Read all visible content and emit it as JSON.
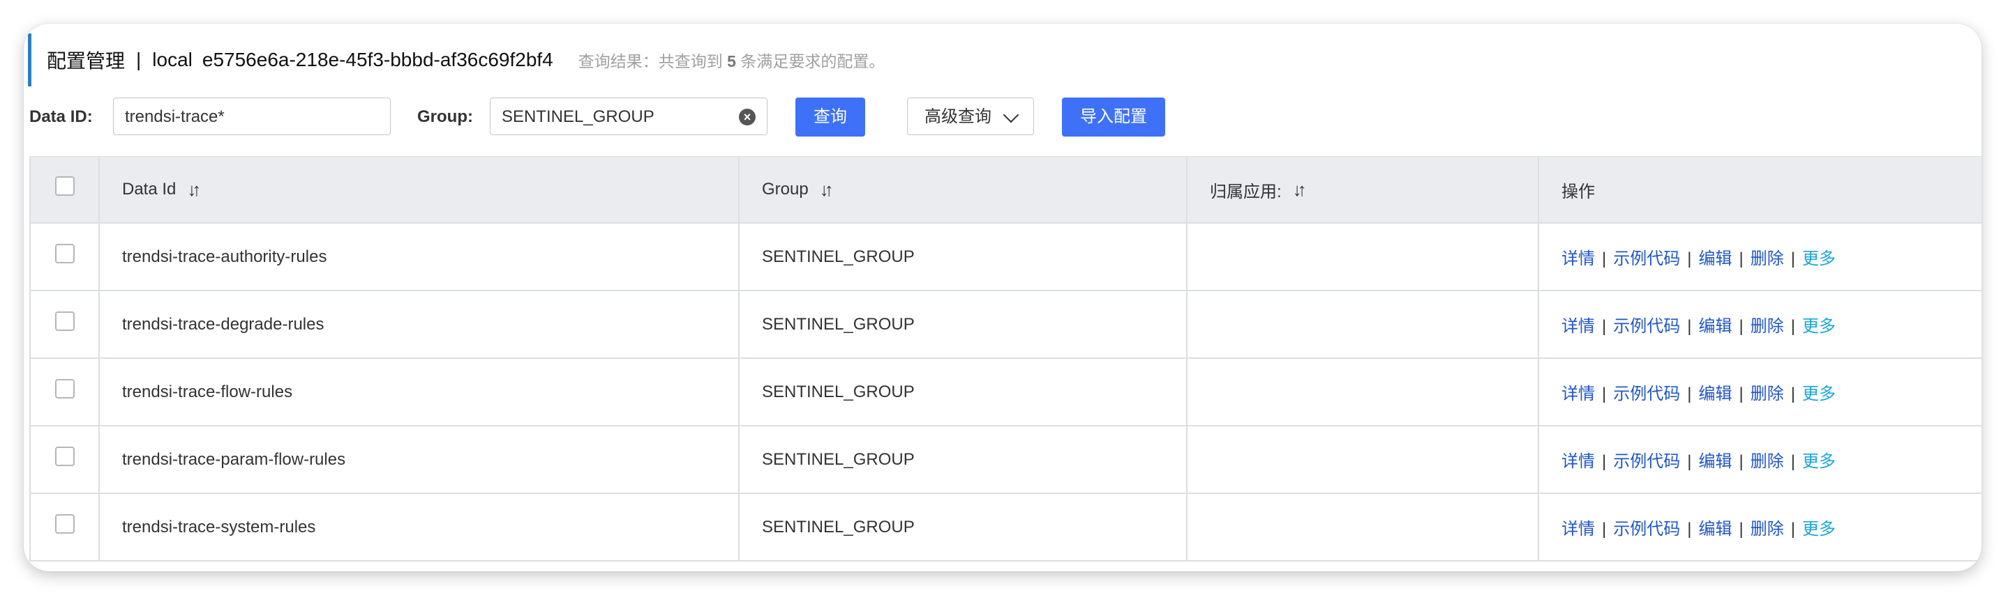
{
  "header": {
    "title": "配置管理",
    "separator": "|",
    "namespace_name": "local",
    "namespace_id": "e5756e6a-218e-45f3-bbbd-af36c69f2bf4",
    "result_prefix": "查询结果：共查询到",
    "result_count": "5",
    "result_suffix": "条满足要求的配置。"
  },
  "search": {
    "data_id_label": "Data ID:",
    "data_id_value": "trendsi-trace*",
    "group_label": "Group:",
    "group_value": "SENTINEL_GROUP",
    "query_button": "查询",
    "advanced_button": "高级查询",
    "import_button": "导入配置"
  },
  "table": {
    "columns": {
      "data_id": "Data Id",
      "group": "Group",
      "app": "归属应用:",
      "actions": "操作"
    },
    "rows": [
      {
        "data_id": "trendsi-trace-authority-rules",
        "group": "SENTINEL_GROUP",
        "app": ""
      },
      {
        "data_id": "trendsi-trace-degrade-rules",
        "group": "SENTINEL_GROUP",
        "app": ""
      },
      {
        "data_id": "trendsi-trace-flow-rules",
        "group": "SENTINEL_GROUP",
        "app": ""
      },
      {
        "data_id": "trendsi-trace-param-flow-rules",
        "group": "SENTINEL_GROUP",
        "app": ""
      },
      {
        "data_id": "trendsi-trace-system-rules",
        "group": "SENTINEL_GROUP",
        "app": ""
      }
    ],
    "actions": {
      "detail": "详情",
      "sample_code": "示例代码",
      "edit": "编辑",
      "delete": "删除",
      "more": "更多",
      "separator": "|"
    }
  },
  "icons": {
    "clear": "clear-icon",
    "advanced": "chevron-down-icon",
    "sort": "sort-icon"
  },
  "colors": {
    "accent_border": "#2b7ec2",
    "primary_button": "#3e71f7",
    "link": "#1f56c9",
    "more_link": "#19a6d8",
    "header_bg": "#ebecf0"
  }
}
